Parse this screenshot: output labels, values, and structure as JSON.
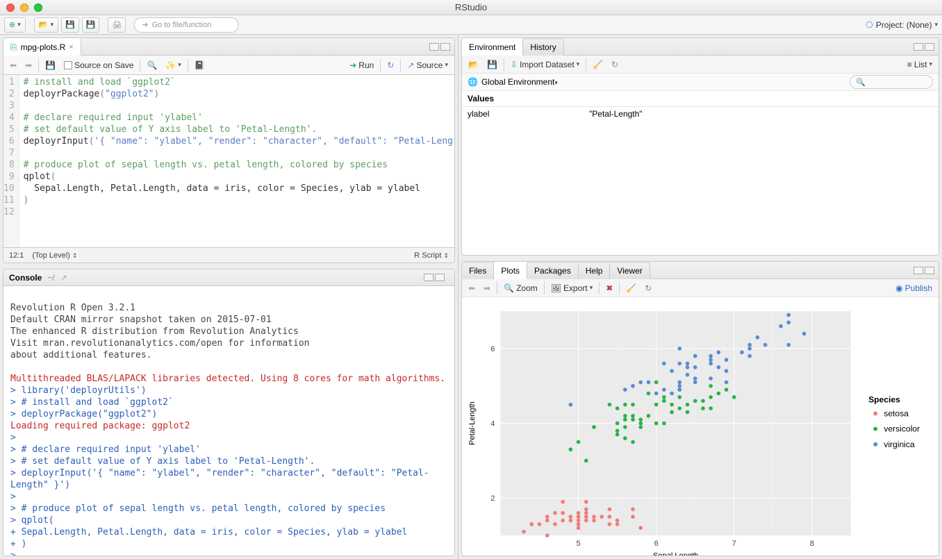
{
  "window": {
    "title": "RStudio"
  },
  "main_toolbar": {
    "goto_placeholder": "Go to file/function",
    "project_label": "Project: (None)"
  },
  "editor": {
    "file_tab": "mpg-plots.R",
    "source_on_save": "Source on Save",
    "run_btn": "Run",
    "source_btn": "Source",
    "cursor_pos": "12:1",
    "scope": "(Top Level)",
    "lang": "R Script",
    "lines": [
      {
        "n": 1,
        "spans": [
          {
            "t": "# install and load `ggplot2`",
            "cls": "c-comment"
          }
        ]
      },
      {
        "n": 2,
        "spans": [
          {
            "t": "deployrPackage",
            "cls": "c-func"
          },
          {
            "t": "(",
            "cls": "c-paren"
          },
          {
            "t": "\"ggplot2\"",
            "cls": "c-string"
          },
          {
            "t": ")",
            "cls": "c-paren"
          }
        ]
      },
      {
        "n": 3,
        "spans": [
          {
            "t": "",
            "cls": ""
          }
        ]
      },
      {
        "n": 4,
        "spans": [
          {
            "t": "# declare required input 'ylabel'",
            "cls": "c-comment"
          }
        ]
      },
      {
        "n": 5,
        "spans": [
          {
            "t": "# set default value of Y axis label to 'Petal-Length'.",
            "cls": "c-comment"
          }
        ]
      },
      {
        "n": 6,
        "spans": [
          {
            "t": "deployrInput",
            "cls": "c-func"
          },
          {
            "t": "(",
            "cls": "c-paren"
          },
          {
            "t": "'{ \"name\": \"ylabel\", \"render\": \"character\", \"default\": \"Petal-Length\" }'",
            "cls": "c-string"
          },
          {
            "t": ")",
            "cls": "c-paren"
          }
        ]
      },
      {
        "n": 7,
        "spans": [
          {
            "t": "",
            "cls": ""
          }
        ]
      },
      {
        "n": 8,
        "spans": [
          {
            "t": "# produce plot of sepal length vs. petal length, colored by species",
            "cls": "c-comment"
          }
        ]
      },
      {
        "n": 9,
        "spans": [
          {
            "t": "qplot",
            "cls": "c-func"
          },
          {
            "t": "(",
            "cls": "c-paren"
          }
        ]
      },
      {
        "n": 10,
        "spans": [
          {
            "t": "  Sepal.Length, Petal.Length, data = iris, color = Species, ylab = ylabel",
            "cls": ""
          }
        ]
      },
      {
        "n": 11,
        "spans": [
          {
            "t": ")",
            "cls": "c-paren"
          }
        ]
      },
      {
        "n": 12,
        "spans": [
          {
            "t": "",
            "cls": ""
          }
        ]
      }
    ]
  },
  "console": {
    "title": "Console",
    "path": "~/",
    "lines": [
      {
        "t": "",
        "cls": "con-grey"
      },
      {
        "t": "Revolution R Open 3.2.1",
        "cls": "con-grey"
      },
      {
        "t": "Default CRAN mirror snapshot taken on 2015-07-01",
        "cls": "con-grey"
      },
      {
        "t": "The enhanced R distribution from Revolution Analytics",
        "cls": "con-grey"
      },
      {
        "t": "Visit mran.revolutionanalytics.com/open for information",
        "cls": "con-grey"
      },
      {
        "t": "about additional features.",
        "cls": "con-grey"
      },
      {
        "t": "",
        "cls": "con-grey"
      },
      {
        "t": "Multithreaded BLAS/LAPACK libraries detected. Using 8 cores for math algorithms.",
        "cls": "con-red"
      },
      {
        "t": "> library('deployrUtils')",
        "cls": "con-blue"
      },
      {
        "t": "> # install and load `ggplot2`",
        "cls": "con-blue"
      },
      {
        "t": "> deployrPackage(\"ggplot2\")",
        "cls": "con-blue"
      },
      {
        "t": "Loading required package: ggplot2",
        "cls": "con-red"
      },
      {
        "t": "> ",
        "cls": "con-blue"
      },
      {
        "t": "> # declare required input 'ylabel'",
        "cls": "con-blue"
      },
      {
        "t": "> # set default value of Y axis label to 'Petal-Length'.",
        "cls": "con-blue"
      },
      {
        "t": "> deployrInput('{ \"name\": \"ylabel\", \"render\": \"character\", \"default\": \"Petal-Length\" }')",
        "cls": "con-blue"
      },
      {
        "t": "> ",
        "cls": "con-blue"
      },
      {
        "t": "> # produce plot of sepal length vs. petal length, colored by species",
        "cls": "con-blue"
      },
      {
        "t": "> qplot(",
        "cls": "con-blue"
      },
      {
        "t": "+   Sepal.Length, Petal.Length, data = iris, color = Species, ylab = ylabel",
        "cls": "con-blue"
      },
      {
        "t": "+ )",
        "cls": "con-blue"
      },
      {
        "t": "> ",
        "cls": "con-blue"
      }
    ]
  },
  "env": {
    "tabs": [
      "Environment",
      "History"
    ],
    "import_label": "Import Dataset",
    "view_mode": "List",
    "scope_label": "Global Environment",
    "section": "Values",
    "rows": [
      {
        "name": "ylabel",
        "value": "\"Petal-Length\""
      }
    ]
  },
  "plottabs": {
    "tabs": [
      "Files",
      "Plots",
      "Packages",
      "Help",
      "Viewer"
    ],
    "active": 1,
    "zoom": "Zoom",
    "export": "Export",
    "publish": "Publish"
  },
  "chart_data": {
    "type": "scatter",
    "xlabel": "Sepal.Length",
    "ylabel": "Petal-Length",
    "legend_title": "Species",
    "xlim": [
      4,
      8.5
    ],
    "ylim": [
      1,
      7
    ],
    "xticks": [
      5,
      6,
      7,
      8
    ],
    "yticks": [
      2,
      4,
      6
    ],
    "series": [
      {
        "name": "setosa",
        "color": "#f07d7a",
        "points": [
          [
            4.3,
            1.1
          ],
          [
            4.4,
            1.3
          ],
          [
            4.4,
            1.3
          ],
          [
            4.5,
            1.3
          ],
          [
            4.6,
            1.0
          ],
          [
            4.6,
            1.4
          ],
          [
            4.6,
            1.5
          ],
          [
            4.7,
            1.3
          ],
          [
            4.7,
            1.6
          ],
          [
            4.8,
            1.4
          ],
          [
            4.8,
            1.6
          ],
          [
            4.8,
            1.9
          ],
          [
            4.9,
            1.4
          ],
          [
            4.9,
            1.5
          ],
          [
            5.0,
            1.2
          ],
          [
            5.0,
            1.3
          ],
          [
            5.0,
            1.4
          ],
          [
            5.0,
            1.5
          ],
          [
            5.0,
            1.6
          ],
          [
            5.1,
            1.4
          ],
          [
            5.1,
            1.5
          ],
          [
            5.1,
            1.6
          ],
          [
            5.1,
            1.7
          ],
          [
            5.1,
            1.9
          ],
          [
            5.2,
            1.4
          ],
          [
            5.2,
            1.5
          ],
          [
            5.3,
            1.5
          ],
          [
            5.4,
            1.3
          ],
          [
            5.4,
            1.5
          ],
          [
            5.4,
            1.7
          ],
          [
            5.5,
            1.3
          ],
          [
            5.5,
            1.4
          ],
          [
            5.7,
            1.5
          ],
          [
            5.7,
            1.7
          ],
          [
            5.8,
            1.2
          ]
        ]
      },
      {
        "name": "versicolor",
        "color": "#29b348",
        "points": [
          [
            4.9,
            3.3
          ],
          [
            5.0,
            3.5
          ],
          [
            5.1,
            3.0
          ],
          [
            5.2,
            3.9
          ],
          [
            5.4,
            4.5
          ],
          [
            5.5,
            3.7
          ],
          [
            5.5,
            3.8
          ],
          [
            5.5,
            4.0
          ],
          [
            5.5,
            4.4
          ],
          [
            5.6,
            3.6
          ],
          [
            5.6,
            3.9
          ],
          [
            5.6,
            4.1
          ],
          [
            5.6,
            4.2
          ],
          [
            5.6,
            4.5
          ],
          [
            5.7,
            3.5
          ],
          [
            5.7,
            4.1
          ],
          [
            5.7,
            4.2
          ],
          [
            5.7,
            4.5
          ],
          [
            5.8,
            3.9
          ],
          [
            5.8,
            4.0
          ],
          [
            5.8,
            4.1
          ],
          [
            5.9,
            4.2
          ],
          [
            5.9,
            4.8
          ],
          [
            6.0,
            4.0
          ],
          [
            6.0,
            4.5
          ],
          [
            6.0,
            5.1
          ],
          [
            6.1,
            4.0
          ],
          [
            6.1,
            4.6
          ],
          [
            6.1,
            4.7
          ],
          [
            6.2,
            4.3
          ],
          [
            6.2,
            4.5
          ],
          [
            6.3,
            4.4
          ],
          [
            6.3,
            4.7
          ],
          [
            6.3,
            4.9
          ],
          [
            6.4,
            4.3
          ],
          [
            6.4,
            4.5
          ],
          [
            6.5,
            4.6
          ],
          [
            6.6,
            4.4
          ],
          [
            6.6,
            4.6
          ],
          [
            6.7,
            4.4
          ],
          [
            6.7,
            4.7
          ],
          [
            6.7,
            5.0
          ],
          [
            6.8,
            4.8
          ],
          [
            6.9,
            4.9
          ],
          [
            7.0,
            4.7
          ]
        ]
      },
      {
        "name": "virginica",
        "color": "#5a8ad8",
        "points": [
          [
            4.9,
            4.5
          ],
          [
            5.6,
            4.9
          ],
          [
            5.7,
            5.0
          ],
          [
            5.8,
            5.1
          ],
          [
            5.9,
            5.1
          ],
          [
            6.0,
            4.8
          ],
          [
            6.1,
            4.9
          ],
          [
            6.1,
            5.6
          ],
          [
            6.2,
            4.8
          ],
          [
            6.2,
            5.4
          ],
          [
            6.3,
            4.9
          ],
          [
            6.3,
            5.0
          ],
          [
            6.3,
            5.1
          ],
          [
            6.3,
            5.6
          ],
          [
            6.3,
            6.0
          ],
          [
            6.4,
            5.3
          ],
          [
            6.4,
            5.5
          ],
          [
            6.4,
            5.6
          ],
          [
            6.5,
            5.1
          ],
          [
            6.5,
            5.2
          ],
          [
            6.5,
            5.5
          ],
          [
            6.5,
            5.8
          ],
          [
            6.7,
            5.2
          ],
          [
            6.7,
            5.6
          ],
          [
            6.7,
            5.7
          ],
          [
            6.7,
            5.8
          ],
          [
            6.8,
            5.5
          ],
          [
            6.8,
            5.9
          ],
          [
            6.9,
            5.1
          ],
          [
            6.9,
            5.4
          ],
          [
            6.9,
            5.7
          ],
          [
            7.1,
            5.9
          ],
          [
            7.2,
            5.8
          ],
          [
            7.2,
            6.0
          ],
          [
            7.2,
            6.1
          ],
          [
            7.3,
            6.3
          ],
          [
            7.4,
            6.1
          ],
          [
            7.6,
            6.6
          ],
          [
            7.7,
            6.1
          ],
          [
            7.7,
            6.7
          ],
          [
            7.7,
            6.9
          ],
          [
            7.9,
            6.4
          ]
        ]
      }
    ]
  }
}
